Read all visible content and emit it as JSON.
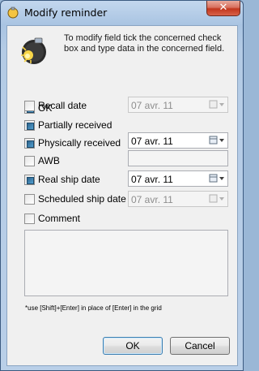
{
  "window": {
    "title": "Modify reminder",
    "close_glyph": "✕"
  },
  "info": {
    "icon": "lightbulb-info-icon",
    "text": "To modify field tick the concerned check box and type data in the concerned field."
  },
  "fields": {
    "ok": {
      "label": "OK",
      "checked": true
    },
    "recall_date": {
      "label": "Recall date",
      "checked": false,
      "value": "07 avr.  11",
      "enabled": false
    },
    "partially_received": {
      "label": "Partially received",
      "checked": true
    },
    "physically_received": {
      "label": "Physically received",
      "checked": true,
      "value": "07 avr.  11",
      "enabled": true
    },
    "awb": {
      "label": "AWB",
      "checked": false,
      "value": ""
    },
    "real_ship_date": {
      "label": "Real ship date",
      "checked": true,
      "value": "07 avr.  11",
      "enabled": true
    },
    "scheduled_ship_date": {
      "label": "Scheduled ship date",
      "checked": false,
      "value": "07 avr.  11",
      "enabled": false
    },
    "comment": {
      "label": "Comment",
      "checked": false,
      "value": ""
    }
  },
  "note": "*use [Shift]+[Enter] in place of [Enter] in the grid",
  "buttons": {
    "ok": "OK",
    "cancel": "Cancel"
  },
  "colors": {
    "checkbox_fill": "#3a7fb5",
    "close_button": "#c7432b"
  }
}
